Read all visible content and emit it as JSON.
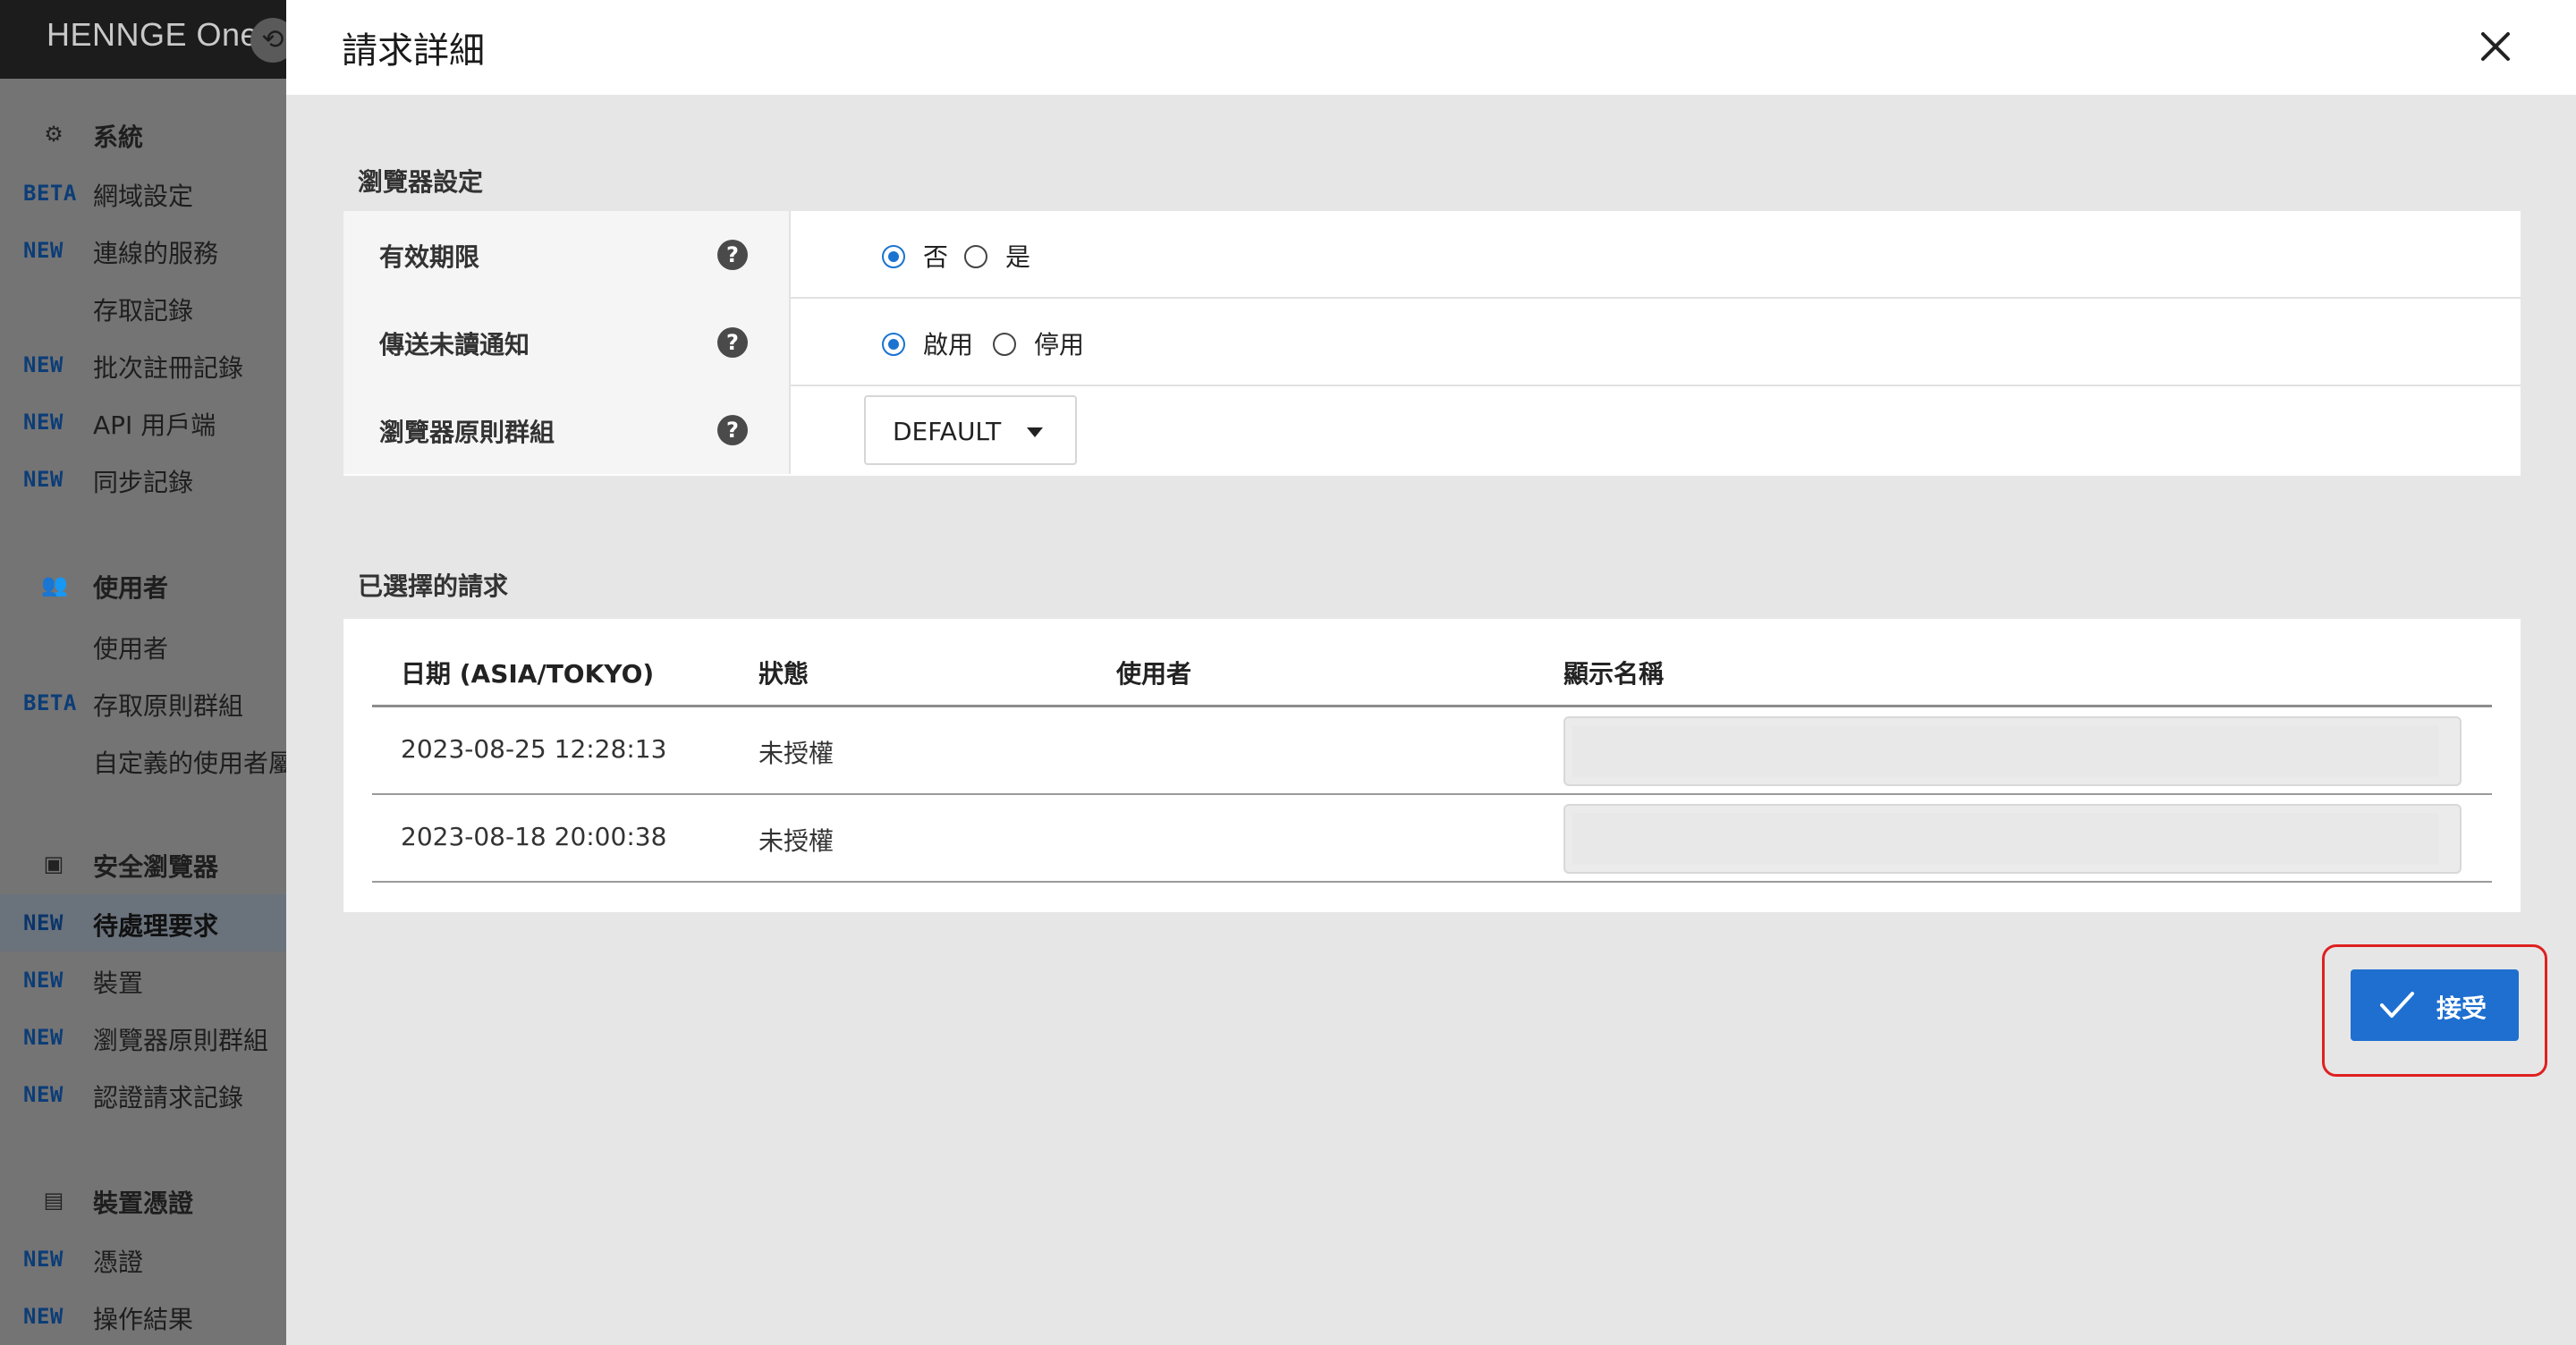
{
  "brand": {
    "name": "HENNGE One"
  },
  "sidebar": {
    "sections": [
      {
        "label": "系統",
        "icon": "gear-icon"
      },
      {
        "label": "使用者",
        "icon": "users-icon"
      },
      {
        "label": "安全瀏覽器",
        "icon": "browser-icon"
      },
      {
        "label": "裝置憑證",
        "icon": "certificate-icon"
      }
    ],
    "items": [
      {
        "badge": "BETA",
        "label": "網域設定"
      },
      {
        "badge": "NEW",
        "label": "連線的服務"
      },
      {
        "badge": "",
        "label": "存取記錄"
      },
      {
        "badge": "NEW",
        "label": "批次註冊記錄"
      },
      {
        "badge": "NEW",
        "label": "API 用戶端"
      },
      {
        "badge": "NEW",
        "label": "同步記錄"
      },
      {
        "badge": "",
        "label": "使用者"
      },
      {
        "badge": "BETA",
        "label": "存取原則群組"
      },
      {
        "badge": "",
        "label": "自定義的使用者屬性"
      },
      {
        "badge": "NEW",
        "label": "待處理要求"
      },
      {
        "badge": "NEW",
        "label": "裝置"
      },
      {
        "badge": "NEW",
        "label": "瀏覽器原則群組"
      },
      {
        "badge": "NEW",
        "label": "認證請求記錄"
      },
      {
        "badge": "NEW",
        "label": "憑證"
      },
      {
        "badge": "NEW",
        "label": "操作結果"
      }
    ]
  },
  "modal": {
    "title": "請求詳細",
    "browser_settings": {
      "title": "瀏覽器設定",
      "expiry": {
        "label": "有效期限",
        "options": [
          "否",
          "是"
        ],
        "selected": "否"
      },
      "unread_notice": {
        "label": "傳送未讀通知",
        "options": [
          "啟用",
          "停用"
        ],
        "selected": "啟用"
      },
      "policy_group": {
        "label": "瀏覽器原則群組",
        "value": "DEFAULT"
      }
    },
    "selected_requests": {
      "title": "已選擇的請求",
      "columns": [
        "日期 (ASIA/TOKYO)",
        "狀態",
        "使用者",
        "顯示名稱"
      ],
      "rows": [
        {
          "date": "2023-08-25 12:28:13",
          "status": "未授權",
          "user": "",
          "display_name": ""
        },
        {
          "date": "2023-08-18 20:00:38",
          "status": "未授權",
          "user": "",
          "display_name": ""
        }
      ]
    },
    "accept_label": "接受"
  },
  "colors": {
    "accent": "#1e6fd0",
    "highlight": "#e02020",
    "badge": "#0c3d77"
  }
}
